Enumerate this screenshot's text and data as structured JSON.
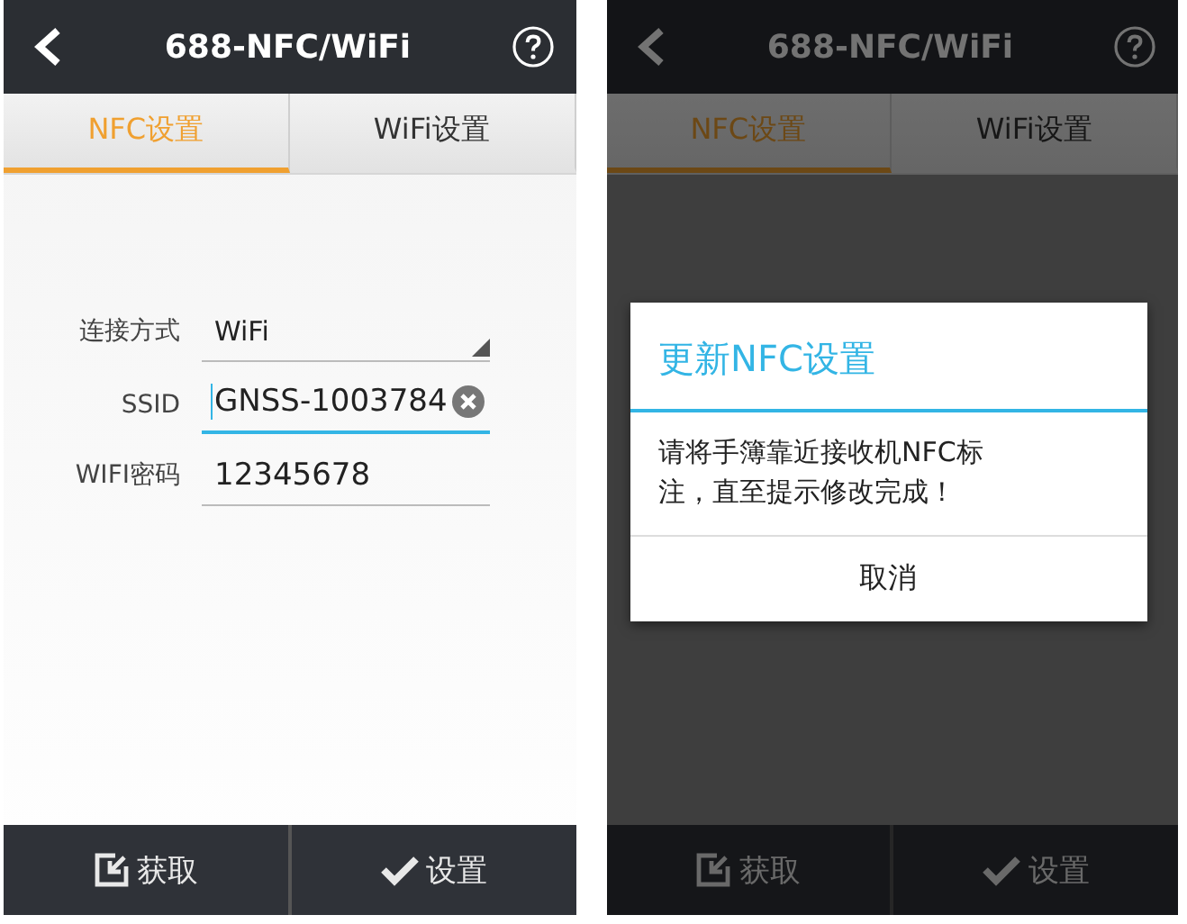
{
  "screens": [
    {
      "title": "688-NFC/WiFi",
      "dimmed": false,
      "tabs": [
        {
          "label": "NFC设置",
          "selected": true
        },
        {
          "label": "WiFi设置",
          "selected": false
        }
      ],
      "fields": [
        {
          "kind": "select",
          "label": "连接方式",
          "value": "WiFi",
          "focused": false
        },
        {
          "kind": "input",
          "label": "SSID",
          "value": "GNSS-1003784",
          "focused": true
        },
        {
          "kind": "input",
          "label": "WIFI密码",
          "value": "12345678",
          "focused": false
        }
      ],
      "buttons": [
        "获取",
        "设置"
      ]
    },
    {
      "title": "688-NFC/WiFi",
      "dimmed": true,
      "tabs": [
        {
          "label": "NFC设置",
          "selected": true
        },
        {
          "label": "WiFi设置",
          "selected": false
        }
      ],
      "dialog": {
        "title": "更新NFC设置",
        "message": "请将手簿靠近接收机NFC标注，直至提示修改完成！",
        "button": "取消"
      },
      "buttons": [
        "获取",
        "设置"
      ]
    }
  ]
}
